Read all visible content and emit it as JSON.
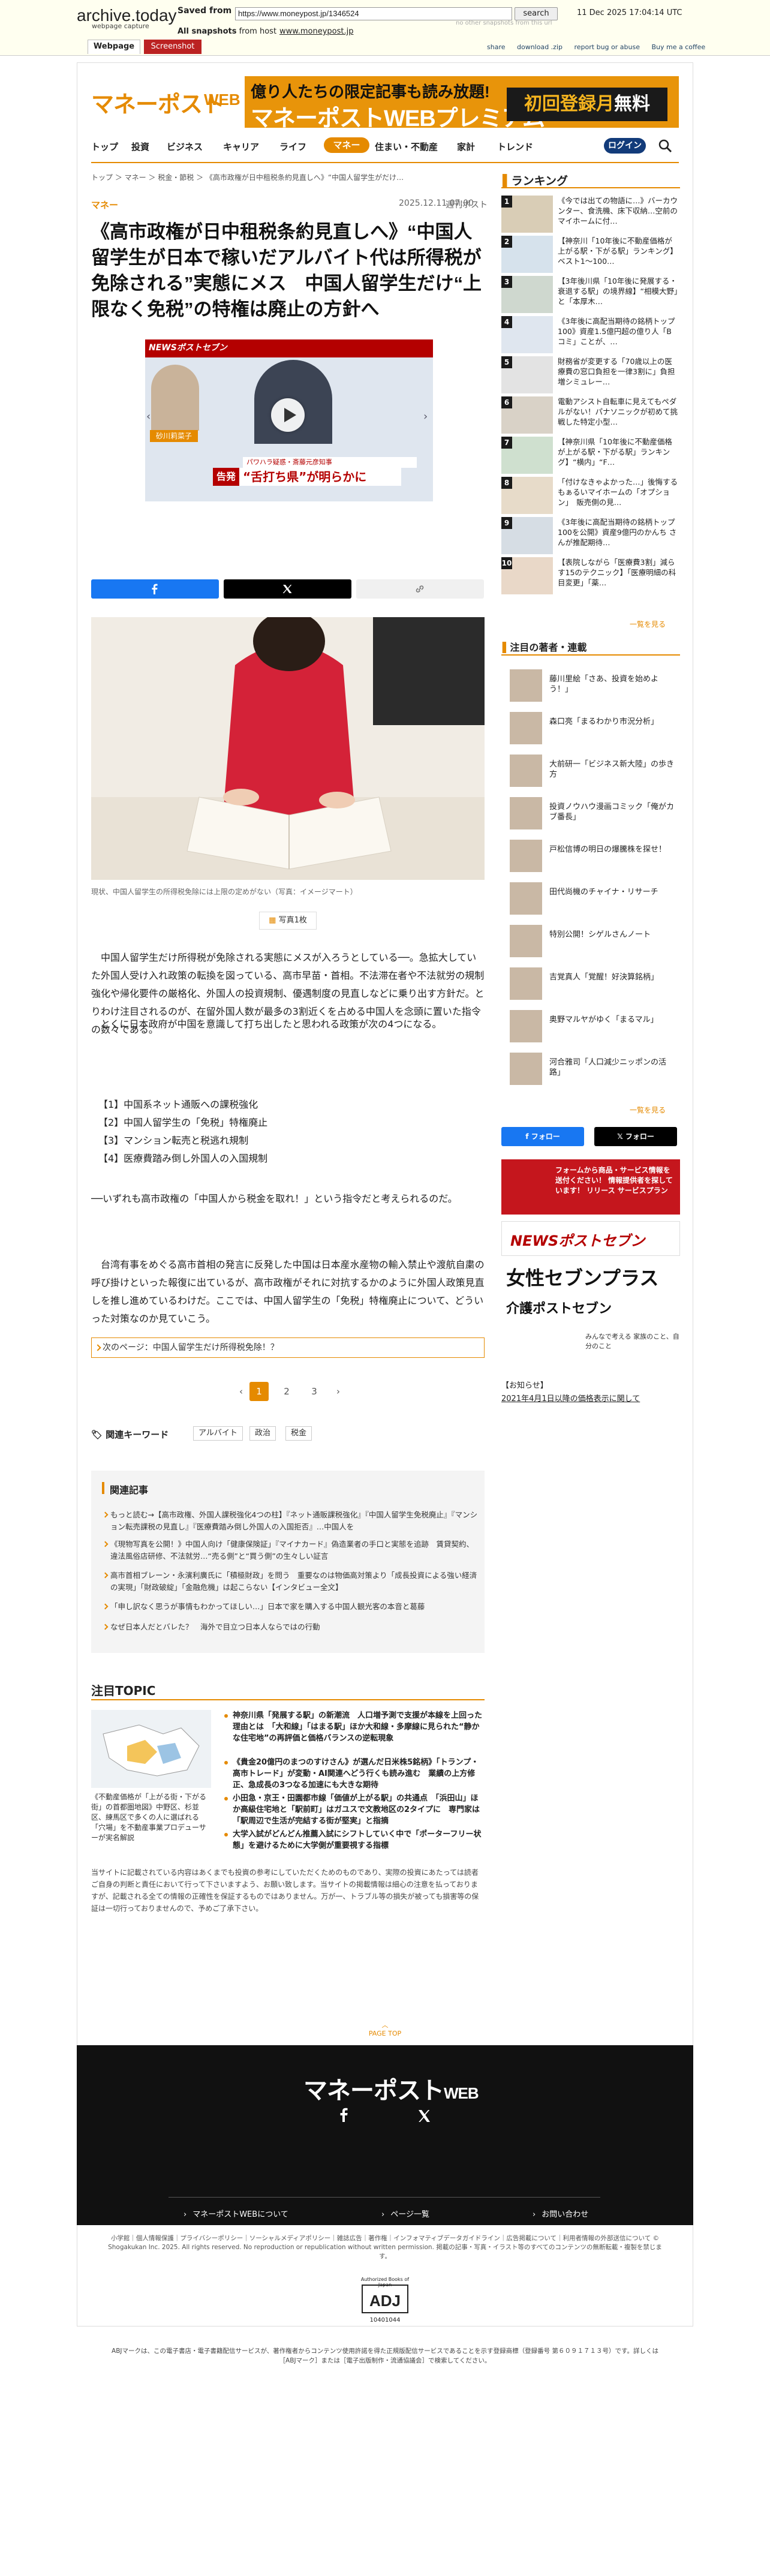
{
  "archive": {
    "logo": "archive.today",
    "logo_sub": "webpage capture",
    "saved_from_label": "Saved from",
    "saved_url": "https://www.moneypost.jp/1346524",
    "search_btn": "search",
    "date": "11 Dec 2025 17:04:14 UTC",
    "no_other": "no other snapshots from this url",
    "all_snapshots_label": "All snapshots",
    "from_host": "from host",
    "host": "www.moneypost.jp",
    "links": [
      "share",
      "download .zip",
      "report bug or abuse",
      "Buy me a coffee"
    ],
    "tab_webpage": "Webpage",
    "tab_screenshot": "Screenshot"
  },
  "site": {
    "logo_main": "マネーポスト",
    "logo_web": "WEB",
    "banner_line1": "億り人たちの限定記事も読み放題!",
    "banner_line2": "マネーポストWEBプレミアム",
    "banner_cta_a": "初回登録月",
    "banner_cta_b": "無料"
  },
  "nav": {
    "items": [
      "トップ",
      "投資",
      "ビジネス",
      "キャリア",
      "ライフ",
      "マネー",
      "住まい・不動産",
      "家計",
      "トレンド"
    ],
    "active": "マネー",
    "login": "ログイン"
  },
  "breadcrumb": "トップ ＞ マネー ＞ 税金・節税 ＞ 《高市政権が日中租税条約見直しへ》“中国人留学生がだけ…",
  "article": {
    "category": "マネー",
    "date": "2025.12.11 07:00",
    "source": "週刊ポスト",
    "title": "《高市政権が日中租税条約見直しへ》“中国人留学生が日本で稼いだアルバイト代は所得税が免除される”実態にメス　中国人留学生だけ“上限なく免税”の特権は廃止の方針へ",
    "video": {
      "brand": "NEWSポストセブン",
      "name_tag": "砂川莉菜子",
      "caption_small": "パワハラ疑惑・斎藤元彦知事",
      "caption_tag": "告発",
      "caption_big": "“舌打ち県”が明らかに"
    },
    "photo_caption": "現状、中国人留学生の所得税免除には上限の定めがない（写真：イメージマート）",
    "photo_count": "写真1枚",
    "p1": "中国人留学生だけ所得税が免除される実態にメスが入ろうとしている──。急拡大していた外国人受け入れ政策の転換を図っている、高市早苗・首相。不法滞在者や不法就労の規制強化や帰化要件の厳格化、外国人の投資規制、優遇制度の見直しなどに乗り出す方針だ。とりわけ注目されるのが、在留外国人数が最多の3割近くを占める中国人を念頭に置いた指令の数々である。",
    "p2": "とくに日本政府が中国を意識して打ち出したと思われる政策が次の4つになる。",
    "list": [
      "【1】中国系ネット通販への課税強化",
      "【2】中国人留学生の「免税」特権廃止",
      "【3】マンション転売と税逃れ規制",
      "【4】医療費踏み倒し外国人の入国規制"
    ],
    "p3": "──いずれも高市政権の「中国人から税金を取れ！」という指令だと考えられるのだ。",
    "p4": "台湾有事をめぐる高市首相の発言に反発した中国は日本産水産物の輸入禁止や渡航自粛の呼び掛けといった報復に出ているが、高市政権がそれに対抗するかのように外国人政策見直しを推し進めているわけだ。ここでは、中国人留学生の「免税」特権廃止について、どういった対策なのか見ていこう。",
    "next_page": "次のページ：中国人留学生だけ所得税免除！？",
    "pages": [
      "1",
      "2",
      "3"
    ],
    "keywords_label": "関連キーワード",
    "keywords": [
      "アルバイト",
      "政治",
      "税金"
    ]
  },
  "related": {
    "title": "関連記事",
    "items": [
      "もっと読む→【高市政権、外国人課税強化4つの柱】『ネット通販課税強化』『中国人留学生免税廃止』『マンション転売課税の見直し』『医療費踏み倒し外国人の入国拒否』…中国人を",
      "《現物写真を公開！》中国人向け「健康保険証」『マイナカード』偽造業者の手口と実態を追跡　賃貸契約、違法風俗店研修、不法就労…“売る側”と“買う側”の生々しい証言",
      "高市首相ブレーン・永濱利廣氏に「積極財政」を問う　重要なのは物価高対策より「成長投資による強い経済の実現」「財政破綻」「金融危機」は起こらない【インタビュー全文】",
      "「申し訳なく思うが事情もわかってほしい…」日本で家を購入する中国人観光客の本音と葛藤",
      "なぜ日本人だとバレた？　海外で目立つ日本人ならではの行動"
    ]
  },
  "topic": {
    "title": "注目TOPIC",
    "img_caption": "《不動産価格が「上がる街・下がる街」の首都圏地図》中野区、杉並区、練馬区で多くの人に選ばれる「穴場」を不動産事業プロデューサーが実名解説",
    "items": [
      "神奈川県「発展する駅」の新潮流　人口増予測で支援が本線を上回った理由とは　「大和線」「はまる駅」ほか大和線・多摩線に見られた“静かな住宅地”の再評価と価格バランスの逆転現象",
      "《貴金20億円のまつのすけさん》が選んだ日米株5銘柄》「トランプ・高市トレード」が変動・AI関連へどう行くも読み進む　業績の上方修正、急成長の3つなる加速にも大きな期待",
      "小田急・京王・田園都市線「価値が上がる駅」の共通点　「浜田山」ほか高級住宅地と「駅前町」はガユスで文教地区の2タイプに　専門家は「駅周辺で生活が完結する街が堅実」と指摘",
      "大学入試がどんどん推薦入試にシフトしていく中で「ポーターフリー状態」を避けるために大学側が重要視する指標"
    ]
  },
  "disclaimer": "当サイトに記載されている内容はあくまでも投資の参考にしていただくためのものであり、実際の投資にあたっては読者ご自身の判断と責任において行って下さいますよう、お願い致します。当サイトの掲載情報は細心の注意を払っておりますが、記載される全ての情報の正確性を保証するものではありません。万が一、トラブル等の損失が被っても損害等の保証は一切行っておりませんので、予めご了承下さい。",
  "page_top": "PAGE TOP",
  "footer": {
    "logo_main": "マネーポスト",
    "logo_web": "WEB",
    "links": [
      "マネーポストWEBについて",
      "ページ一覧",
      "お問い合わせ"
    ],
    "legal": "小学館｜個人情報保護｜プライバシーポリシー｜ソーシャルメディアポリシー｜雑誌広告｜著作権｜インフォマティブデータガイドライン｜広告掲載について｜利用者情報の外部送信について © Shogakukan Inc. 2025. All rights reserved. No reproduction or republication without written permission. 掲載の記事・写真・イラスト等のすべてのコンテンツの無断転載・複製を禁じます。",
    "adj_label": "Authorized Books of Japan",
    "adj": "ADJ",
    "adj_num": "10401044",
    "adj_text": "ABJマークは、この電子書店・電子書籍配信サービスが、著作権者からコンテンツ使用許諾を得た正規版配信サービスであることを示す登録商標（登録番号 第６０９１７１３号）です。詳しくは［ABJマーク］または［電子出版制作・流通協議会］で検索してください。"
  },
  "sidebar": {
    "ranking_title": "ランキング",
    "ranking": [
      "《今では出ての物語に…》バーカウンター、食洗機、床下収納…空前のマイホームに付…",
      "【神奈川「10年後に不動産価格が上がる駅・下がる駅」ランキング】ベスト1〜100…",
      "【3年後川県「10年後に発展する・衰退する駅」の境界線】“相模大野」と「本厚木…",
      "《3年後に高配当期待の銘柄トップ100》資産1.5億円超の億り人「B コミ」ことが、…",
      "財務省が変更する「70歳以上の医療費の窓口負担を一律3割に」負担増シミュレー…",
      "電動アシスト自転車に見えてもペダルがない！パナソニックが初めて挑戦した特定小型…",
      "【神奈川県「10年後に不動産価格が上がる駅・下がる駅」ランキング】“横内」“F…",
      "「付けなきゃよかった…」後悔するもぁるいマイホームの「オプション」　販売側の見…",
      "《3年後に高配当期待の銘柄トップ100を公開》資産9億円のかんち さんが推配期待…",
      "【表院しながら「医療費3割」減らす15のテクニック】「医療明細の科目変更」「薬…"
    ],
    "more": "一覧を見る",
    "author_title": "注目の著者・連載",
    "authors": [
      "藤川里絵「さあ、投資を始めよう！」",
      "森口亮「まるわかり市況分析」",
      "大前研一「ビジネス新大陸」の歩き方",
      "投資ノウハウ漫画コミック「俺がカブ番長」",
      "戸松信博の明日の爆騰株を探せ！",
      "田代尚機のチャイナ・リサーチ",
      "特別公開！シゲルさんノート",
      "吉覚真人「覚醒！好決算銘柄」",
      "奥野マルヤがゆく「まるマル」",
      "河合雅司「人口減少ニッポンの活路」"
    ],
    "follow_fb": "フォロー",
    "follow_x": "フォロー",
    "banner1": "フォームから商品・サービス情報を送付ください！ 情報提供者を探しています！ リリース サービスプラン",
    "banner2": "NEWSポストセブン",
    "banner3": "女性セブンプラス",
    "banner4": "介護ポストセブン",
    "banner4_sub": "みんなで考える 家族のこと、自分のこと",
    "notice_title": "【お知らせ】",
    "notice_link": "2021年4月1日以降の価格表示に関して"
  }
}
